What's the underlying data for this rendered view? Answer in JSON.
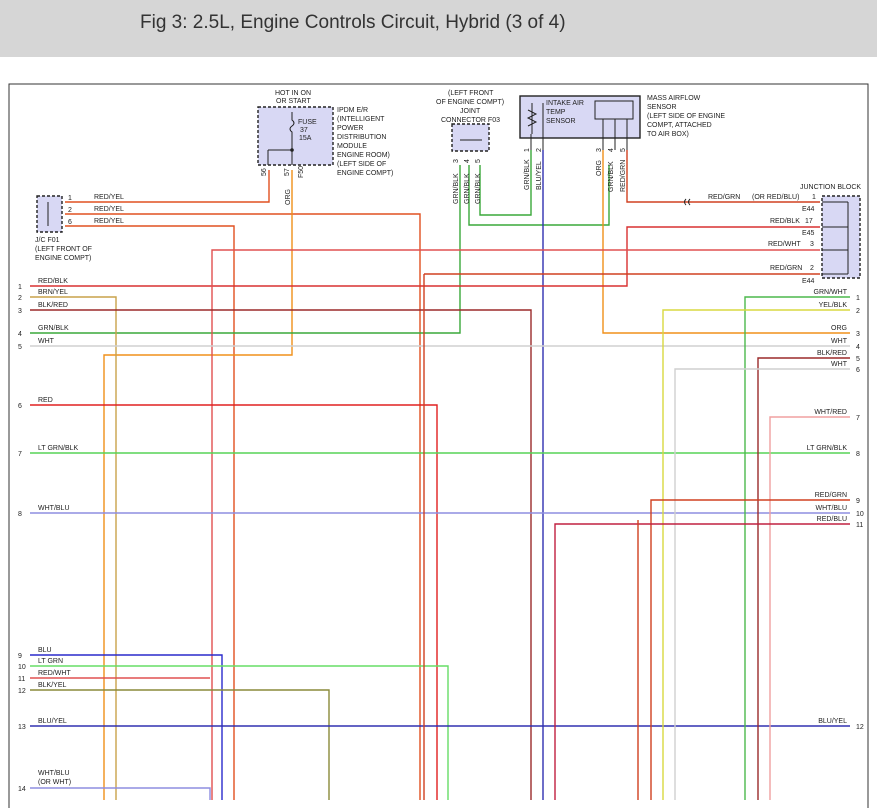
{
  "header": {
    "title": "Fig 3: 2.5L, Engine Controls Circuit, Hybrid (3 of 4)"
  },
  "ipdm": {
    "hot_label": [
      "HOT IN ON",
      "OR START"
    ],
    "desc": [
      "IPDM E/R",
      "(INTELLIGENT",
      "POWER",
      "DISTRIBUTION",
      "MODULE",
      "ENGINE ROOM)",
      "(LEFT SIDE OF",
      "ENGINE COMPT)"
    ],
    "fuse": [
      "FUSE",
      "37",
      "15A"
    ],
    "pins": [
      "56",
      "57"
    ],
    "connector": "F50"
  },
  "jc_f01": {
    "label": [
      "J/C F01",
      "(LEFT FRONT OF",
      "ENGINE COMPT)"
    ],
    "pins": [
      "1",
      "2",
      "6"
    ],
    "wires": [
      "RED/YEL",
      "RED/YEL",
      "RED/YEL"
    ]
  },
  "joint_f03": {
    "label": [
      "(LEFT FRONT",
      "OF ENGINE COMPT)",
      "JOINT",
      "CONNECTOR F03"
    ],
    "pins": [
      "3",
      "4",
      "5"
    ],
    "wires": [
      "GRN/BLK",
      "GRN/BLK",
      "GRN/BLK"
    ]
  },
  "maf": {
    "inner": [
      "INTAKE AIR",
      "TEMP",
      "SENSOR"
    ],
    "label": [
      "MASS AIRFLOW",
      "SENSOR",
      "(LEFT SIDE OF ENGINE",
      "COMPT, ATTACHED",
      "TO AIR BOX)"
    ],
    "pins_left": [
      "1",
      "2"
    ],
    "pins_right": [
      "3",
      "4",
      "5"
    ],
    "wires_left": [
      "GRN/BLK",
      "BLU/YEL"
    ],
    "wires_right": [
      "ORG",
      "GRN/BLK",
      "RED/GRN"
    ]
  },
  "junction_block": {
    "label": "JUNCTION BLOCK",
    "wires": [
      "RED/GRN",
      "(OR RED/BLU)",
      "RED/BLK",
      "RED/WHT",
      "RED/GRN"
    ],
    "pins": [
      "1",
      "17",
      "3",
      "2"
    ],
    "connectors": [
      "E44",
      "E45",
      "E44"
    ],
    "org_label": "ORG"
  },
  "left_lines": [
    {
      "num": "1",
      "label": "RED/BLK",
      "color": "#d93030"
    },
    {
      "num": "2",
      "label": "BRN/YEL",
      "color": "#c9a24a"
    },
    {
      "num": "3",
      "label": "BLK/RED",
      "color": "#9b2a2a"
    },
    {
      "num": "4",
      "label": "GRN/BLK",
      "color": "#3aa83a"
    },
    {
      "num": "5",
      "label": "WHT",
      "color": "#cfcfcf"
    },
    {
      "num": "6",
      "label": "RED",
      "color": "#e02020"
    },
    {
      "num": "7",
      "label": "LT GRN/BLK",
      "color": "#56d456"
    },
    {
      "num": "8",
      "label": "WHT/BLU",
      "color": "#8d8de0"
    },
    {
      "num": "9",
      "label": "BLU",
      "color": "#2a2acc"
    },
    {
      "num": "10",
      "label": "LT GRN",
      "color": "#66dd66"
    },
    {
      "num": "11",
      "label": "RED/WHT",
      "color": "#e05050"
    },
    {
      "num": "12",
      "label": "BLK/YEL",
      "color": "#8a8a3a"
    },
    {
      "num": "13",
      "label": "BLU/YEL",
      "color": "#3030b0"
    },
    {
      "num": "14",
      "label": "WHT/BLU",
      "label2": "(OR WHT)",
      "color": "#8d8de0"
    }
  ],
  "right_lines": [
    {
      "num": "1",
      "label": "GRN/WHT",
      "color": "#4cb84c"
    },
    {
      "num": "2",
      "label": "YEL/BLK",
      "color": "#d8d840"
    },
    {
      "num": "3",
      "label": "ORG",
      "color": "#f0901a"
    },
    {
      "num": "4",
      "label": "WHT",
      "color": "#cfcfcf"
    },
    {
      "num": "5",
      "label": "BLK/RED",
      "color": "#9b2a2a"
    },
    {
      "num": "6",
      "label": "WHT",
      "color": "#cfcfcf"
    },
    {
      "num": "7",
      "label": "WHT/RED",
      "color": "#f0a0a0"
    },
    {
      "num": "8",
      "label": "LT GRN/BLK",
      "color": "#56d456"
    },
    {
      "num": "9",
      "label": "RED/GRN",
      "color": "#d04020"
    },
    {
      "num": "10",
      "label": "WHT/BLU",
      "color": "#8d8de0"
    },
    {
      "num": "11",
      "label": "RED/BLU",
      "color": "#c02040"
    },
    {
      "num": "12",
      "label": "BLU/YEL",
      "color": "#3030b0"
    }
  ]
}
